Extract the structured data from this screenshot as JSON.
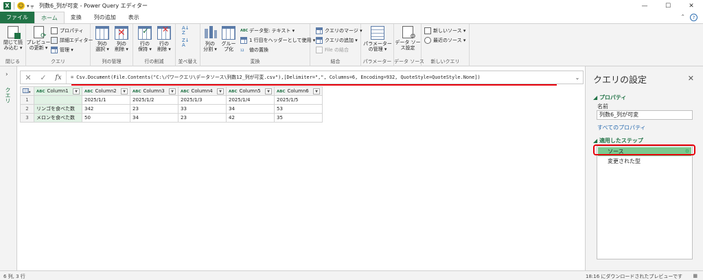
{
  "titlebar": {
    "app_letter": "X",
    "quick_access": "▾ ╤",
    "title": "列数6_列が可変 - Power Query エディター",
    "minimize": "—",
    "maximize": "☐",
    "close": "✕"
  },
  "tabs": [
    "ファイル",
    "ホーム",
    "変換",
    "列の追加",
    "表示"
  ],
  "ribbon": {
    "close_group": {
      "btn": "閉じて読\nみ込む ▾",
      "label": "閉じる"
    },
    "query_group": {
      "preview": "プレビュー\nの更新 ▾",
      "properties": "プロパティ",
      "advanced": "詳細エディター",
      "manage": "管理 ▾",
      "label": "クエリ"
    },
    "columns_group": {
      "choose": "列の\n選択 ▾",
      "remove": "列の\n削除 ▾",
      "label": "列の管理"
    },
    "rows_group": {
      "keep": "行の\n保持 ▾",
      "remove": "行の\n削除 ▾",
      "label": "行の削減"
    },
    "sort_group": {
      "label": "並べ替え"
    },
    "transform_group": {
      "split": "列の\n分割 ▾",
      "group": "グルー\nプ化",
      "datatype": "データ型: テキスト ▾",
      "header": "1 行目をヘッダーとして使用 ▾",
      "replace": "値の置換",
      "label": "変換"
    },
    "combine_group": {
      "merge": "クエリのマージ ▾",
      "append": "クエリの追加 ▾",
      "file_combine": "File の結合",
      "label": "結合"
    },
    "params_group": {
      "manage": "パラメーター\nの管理 ▾",
      "label": "パラメーター"
    },
    "source_group": {
      "settings": "データ ソー\nス設定",
      "label": "データ ソース"
    },
    "newquery_group": {
      "new_source": "新しいソース ▾",
      "recent": "最近のソース ▾",
      "label": "新しいクエリ"
    }
  },
  "left_pane": {
    "chevron": "›",
    "label": "クエリ"
  },
  "formula_bar": {
    "cancel": "✕",
    "confirm": "✓",
    "fx": "fx",
    "text": "= Csv.Document(File.Contents(\"C:\\パワークエリ\\データソース\\列数12_列が可変.csv\"),[Delimiter=\",\", Columns=6, Encoding=932, QuoteStyle=QuoteStyle.None])",
    "expand": "⌄"
  },
  "table": {
    "type_icon": "ABC",
    "columns": [
      "Column1",
      "Column2",
      "Column3",
      "Column4",
      "Column5",
      "Column6"
    ],
    "rows": [
      {
        "n": "1",
        "cells": [
          "",
          "2025/1/1",
          "2025/1/2",
          "2025/1/3",
          "2025/1/4",
          "2025/1/5"
        ]
      },
      {
        "n": "2",
        "cells": [
          "リンゴを食べた数",
          "342",
          "23",
          "33",
          "34",
          "53"
        ]
      },
      {
        "n": "3",
        "cells": [
          "メロンを食べた数",
          "50",
          "34",
          "23",
          "42",
          "35"
        ]
      }
    ]
  },
  "settings": {
    "title": "クエリの設定",
    "close": "✕",
    "properties_header": "◢ プロパティ",
    "name_label": "名前",
    "name_value": "列数6_列が可変",
    "all_properties": "すべてのプロパティ",
    "steps_header": "◢ 適用したステップ",
    "steps": [
      "ソース",
      "変更された型"
    ],
    "gear": "⚙"
  },
  "status": {
    "left": "6 列, 3 行",
    "right": "18:16 にダウンロードされたプレビューです"
  }
}
